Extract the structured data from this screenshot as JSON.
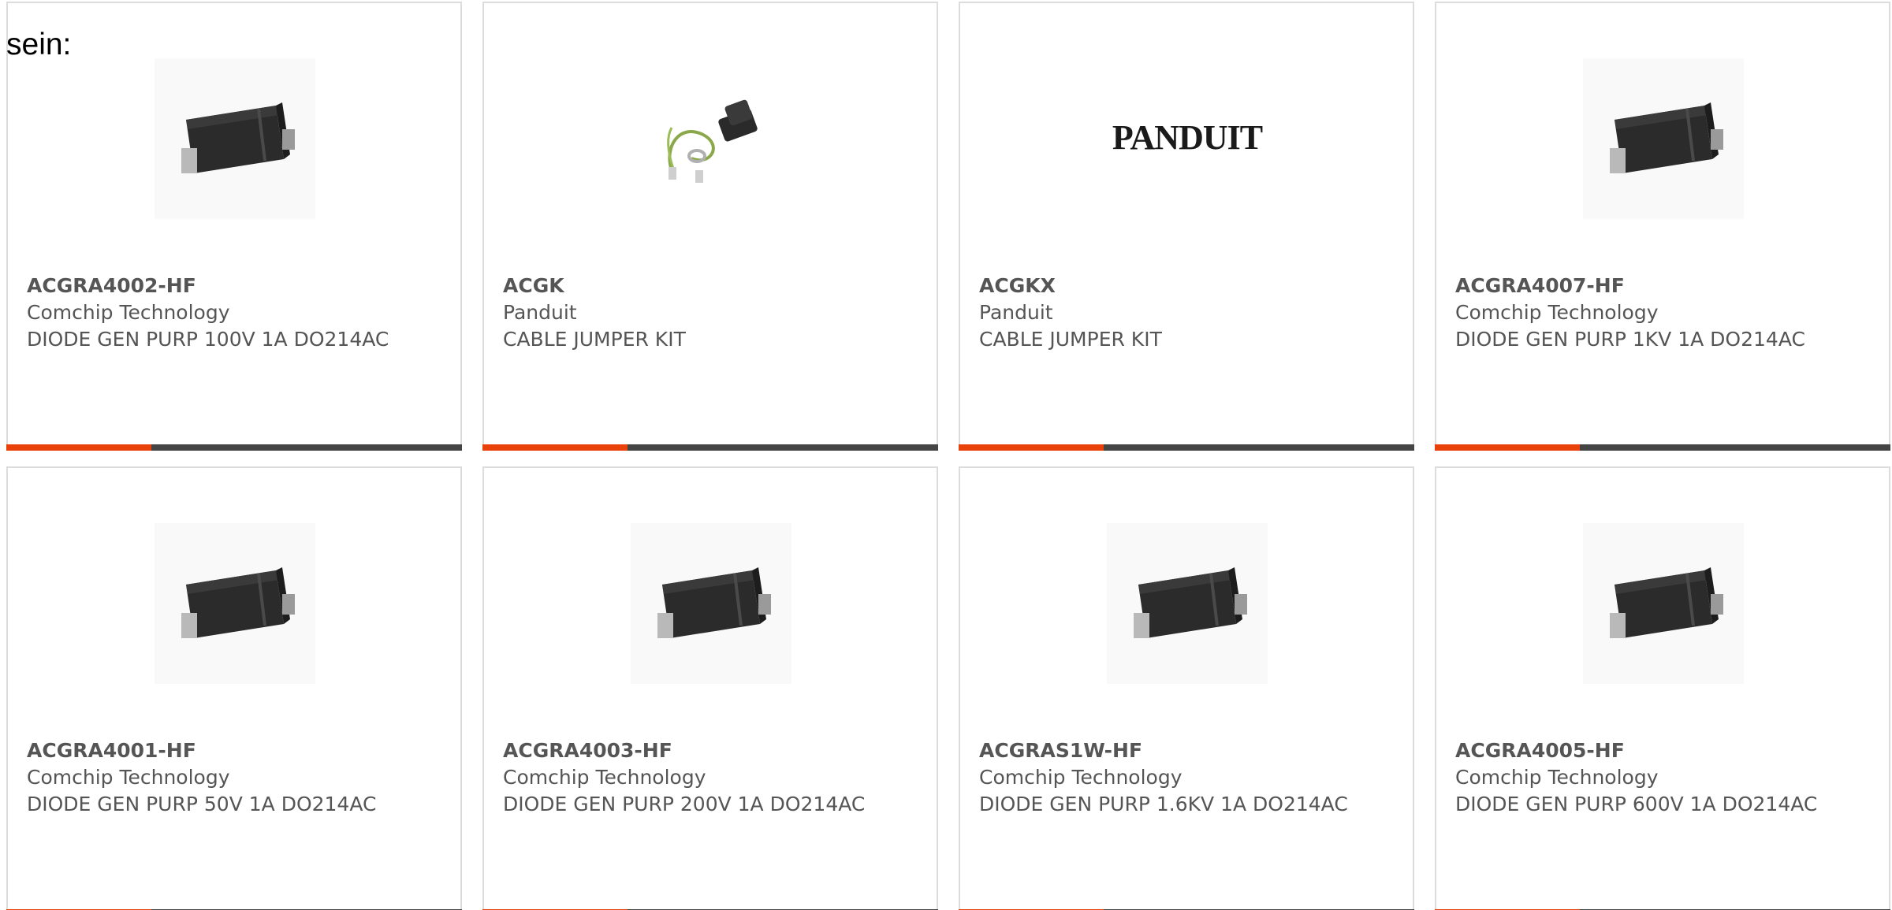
{
  "intro_text": "sein:",
  "colors": {
    "accent": "#e8410a",
    "stripe": "#444444",
    "text": "#555555",
    "border": "#dcdcdc"
  },
  "products": [
    {
      "part": "ACGRA4002-HF",
      "manufacturer": "Comchip Technology",
      "description": "DIODE GEN PURP 100V 1A DO214AC",
      "image": "smd-diode-icon"
    },
    {
      "part": "ACGK",
      "manufacturer": "Panduit",
      "description": "CABLE JUMPER KIT",
      "image": "cable-jumper-kit-icon"
    },
    {
      "part": "ACGKX",
      "manufacturer": "Panduit",
      "description": "CABLE JUMPER KIT",
      "image": "panduit-logo",
      "logo_text": "PANDUIT"
    },
    {
      "part": "ACGRA4007-HF",
      "manufacturer": "Comchip Technology",
      "description": "DIODE GEN PURP 1KV 1A DO214AC",
      "image": "smd-diode-icon"
    },
    {
      "part": "ACGRA4001-HF",
      "manufacturer": "Comchip Technology",
      "description": "DIODE GEN PURP 50V 1A DO214AC",
      "image": "smd-diode-icon"
    },
    {
      "part": "ACGRA4003-HF",
      "manufacturer": "Comchip Technology",
      "description": "DIODE GEN PURP 200V 1A DO214AC",
      "image": "smd-diode-icon"
    },
    {
      "part": "ACGRAS1W-HF",
      "manufacturer": "Comchip Technology",
      "description": "DIODE GEN PURP 1.6KV 1A DO214AC",
      "image": "smd-diode-icon"
    },
    {
      "part": "ACGRA4005-HF",
      "manufacturer": "Comchip Technology",
      "description": "DIODE GEN PURP 600V 1A DO214AC",
      "image": "smd-diode-icon"
    }
  ]
}
